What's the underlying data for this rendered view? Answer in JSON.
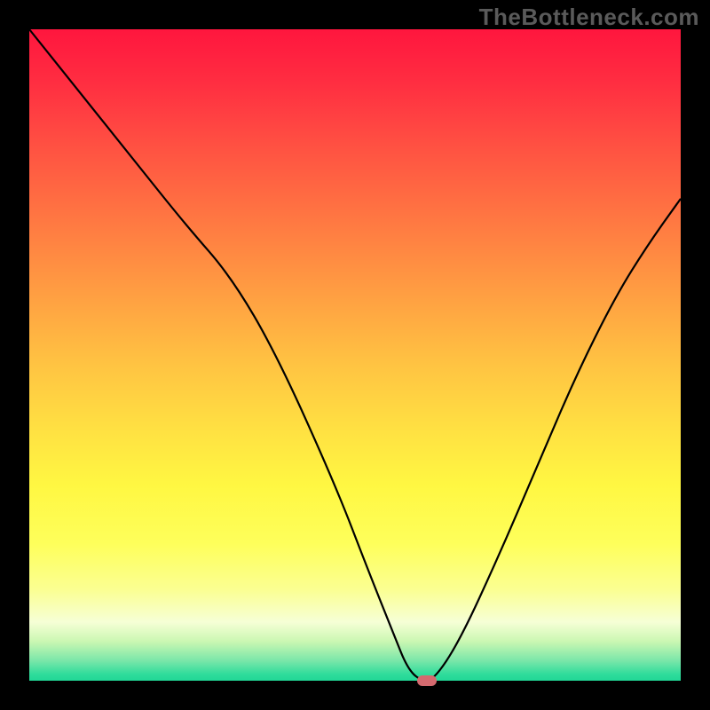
{
  "watermark": "TheBottleneck.com",
  "chart_data": {
    "type": "line",
    "title": "",
    "xlabel": "",
    "ylabel": "",
    "xlim": [
      0,
      100
    ],
    "ylim": [
      0,
      100
    ],
    "x": [
      0,
      8,
      16,
      24,
      31,
      38,
      47,
      52,
      56,
      58,
      60,
      62,
      66,
      72,
      78,
      84,
      90,
      95,
      100
    ],
    "values": [
      100,
      90,
      80,
      70,
      62,
      50,
      30,
      17,
      7,
      2,
      0,
      0,
      6,
      19,
      33,
      47,
      59,
      67,
      74
    ],
    "marker": {
      "x": 61,
      "y": 0
    },
    "gradient_stops": [
      {
        "pos": 0,
        "color": "#ff163e"
      },
      {
        "pos": 50,
        "color": "#ffc542"
      },
      {
        "pos": 85,
        "color": "#fbff92"
      },
      {
        "pos": 100,
        "color": "#21d796"
      }
    ]
  }
}
